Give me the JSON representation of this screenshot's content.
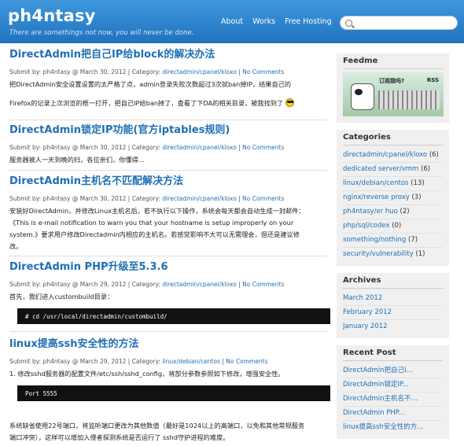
{
  "site": {
    "logo": "ph4ntasy",
    "tagline": "There are somethings not now, you will never be done.",
    "nav": [
      "About",
      "Works",
      "Free Hosting"
    ],
    "search_placeholder": ""
  },
  "posts": [
    {
      "title": "DirectAdmin把自己IP给block的解决办法",
      "submit": "Submit by: ph4ntasy @ March 30, 2012",
      "category_prefix": "Category:",
      "category": "directadmin/cpanel/kloxo",
      "comments": "No Comments",
      "excerpt": [
        "把DirectAdmin安全设置设置的太严格了点，admin登录失败次数超过3次就ban掉IP，结果自己的",
        "Firefox的记录上次浏览的框一打开，把自己IP给ban掉了，查看了下DA的相关目录，被我找到了"
      ]
    },
    {
      "title": "DirectAdmin锁定IP功能(官方iptables规则)",
      "submit": "Submit by: ph4ntasy @ March 30, 2012",
      "category_prefix": "Category:",
      "category": "directadmin/cpanel/kloxo",
      "comments": "No Comments",
      "excerpt": [
        "服务器被人一天到晚的扫，各位亲们，你懂得…"
      ]
    },
    {
      "title": "DirectAdmin主机名不匹配解决方法",
      "submit": "Submit by: ph4ntasy @ March 30, 2012",
      "category_prefix": "Category:",
      "category": "directadmin/cpanel/kloxo",
      "comments": "No Comments",
      "excerpt": [
        "安装好DirectAdmin，并修改Linux主机名后，若不执行以下操作，系统会每天都会自动生成一封邮件：",
        "《This is e-mail notification to warn you that your hostname is setup improperly on your",
        "system.》要求用户修改Directadmin内相应的主机名。若感觉影响不大可以无需理会，但还是建议修",
        "改。"
      ]
    },
    {
      "title": "DirectAdmin PHP升级至5.3.6",
      "submit": "Submit by: ph4ntasy @ March 29, 2012",
      "category_prefix": "Category:",
      "category": "directadmin/cpanel/kloxo",
      "comments": "No Comments",
      "excerpt": [
        "首先，我们进入custombuild目录："
      ],
      "code": "# cd /usr/local/directadmin/custombuild/"
    },
    {
      "title": "linux提高ssh安全性的方法",
      "submit": "Submit by: ph4ntasy @ March 29, 2012",
      "category_prefix": "Category:",
      "category": "linux/debian/centos",
      "comments": "No Comments",
      "excerpt": [
        "1. 修改sshd服务器的配置文件/etc/ssh/sshd_config，将部分参数参照如下修改，增强安全性。"
      ],
      "code": "Port 5555",
      "after": [
        "系统缺省使用22号端口，将监听端口更改为其他数值（最好是1024以上的高端口，以免和其他常规服务",
        "端口冲突），这样可以增加入侵者探测系统是否运行了 sshd守护进程的难度。"
      ]
    }
  ],
  "sidebar": {
    "feed": {
      "title": "Feedme",
      "bubble": "订阅我吗?",
      "rss": "RSS"
    },
    "categories": {
      "title": "Categories",
      "items": [
        {
          "name": "directadmin/cpanel/kloxo",
          "count": "(6)"
        },
        {
          "name": "dedicated server/vmm",
          "count": "(6)"
        },
        {
          "name": "linux/debian/centos",
          "count": "(13)"
        },
        {
          "name": "nginx/reverse proxy",
          "count": "(3)"
        },
        {
          "name": "ph4ntasy/er huo",
          "count": "(2)"
        },
        {
          "name": "php/sql/codex",
          "count": "(0)"
        },
        {
          "name": "something/nothing",
          "count": "(7)"
        },
        {
          "name": "security/vulnerability",
          "count": "(1)"
        }
      ]
    },
    "archives": {
      "title": "Archives",
      "items": [
        "March 2012",
        "February 2012",
        "January 2012"
      ]
    },
    "recent": {
      "title": "Recent Post",
      "items": [
        "DirectAdmin把自己I...",
        "DirectAdmin锁定IP...",
        "DirectAdmin主机名不...",
        "DirectAdmin PHP...",
        "linux提高ssh安全性的方..."
      ]
    }
  }
}
